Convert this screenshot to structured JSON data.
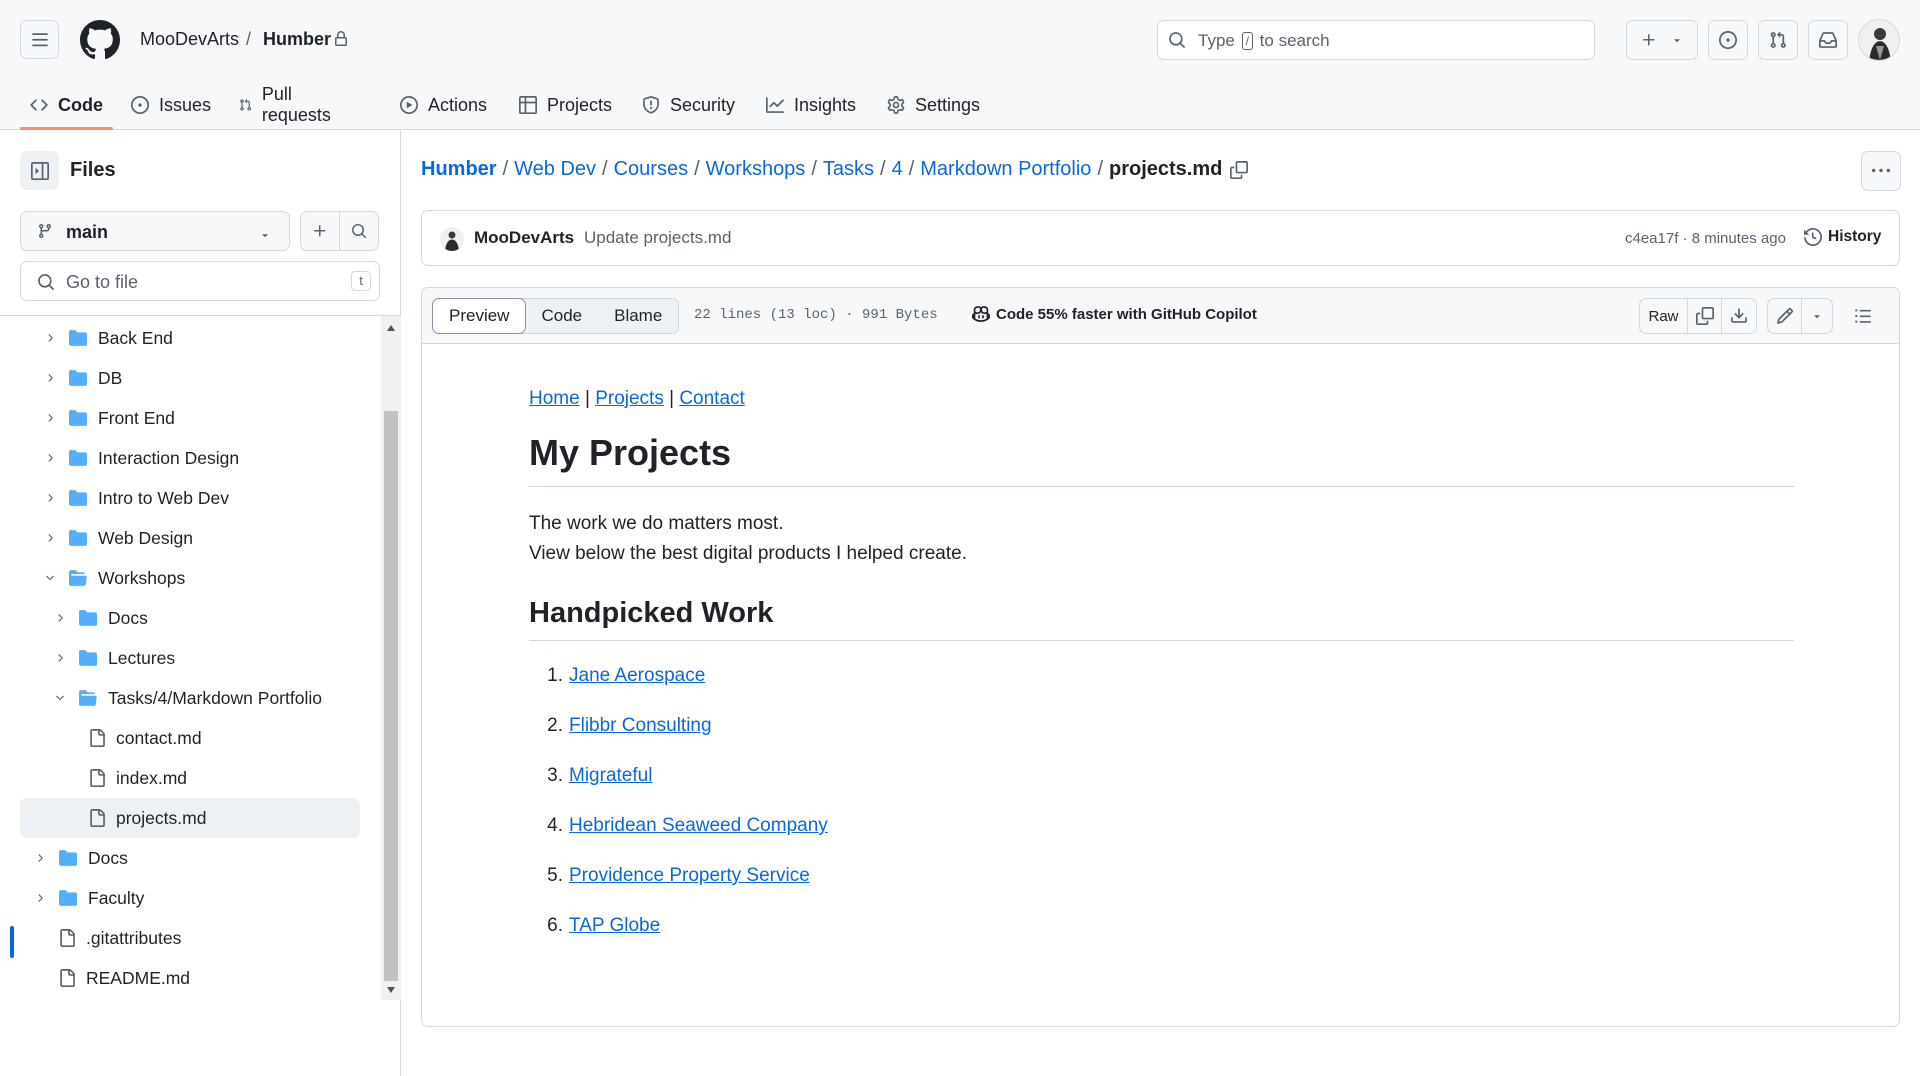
{
  "header": {
    "owner": "MooDevArts",
    "separator": "/",
    "repo": "Humber",
    "search_placeholder_pre": "Type",
    "search_key": "/",
    "search_placeholder_post": "to search"
  },
  "tabs": [
    {
      "label": "Code",
      "icon": "code-icon",
      "active": true
    },
    {
      "label": "Issues",
      "icon": "issue-opened-icon"
    },
    {
      "label": "Pull requests",
      "icon": "git-pull-request-icon"
    },
    {
      "label": "Actions",
      "icon": "play-icon"
    },
    {
      "label": "Projects",
      "icon": "table-icon"
    },
    {
      "label": "Security",
      "icon": "shield-icon"
    },
    {
      "label": "Insights",
      "icon": "graph-icon"
    },
    {
      "label": "Settings",
      "icon": "gear-icon"
    }
  ],
  "sidebar": {
    "title": "Files",
    "branch": "main",
    "goto_placeholder": "Go to file",
    "goto_key": "t",
    "tree": [
      {
        "label": "Back End",
        "type": "folder",
        "open": false
      },
      {
        "label": "DB",
        "type": "folder",
        "open": false
      },
      {
        "label": "Front End",
        "type": "folder",
        "open": false
      },
      {
        "label": "Interaction Design",
        "type": "folder",
        "open": false
      },
      {
        "label": "Intro to Web Dev",
        "type": "folder",
        "open": false
      },
      {
        "label": "Web Design",
        "type": "folder",
        "open": false
      },
      {
        "label": "Workshops",
        "type": "folder",
        "open": true
      },
      {
        "label": "Docs",
        "type": "folder",
        "open": false
      },
      {
        "label": "Lectures",
        "type": "folder",
        "open": false
      },
      {
        "label": "Tasks/4/Markdown Portfolio",
        "type": "folder",
        "open": true
      },
      {
        "label": "contact.md",
        "type": "file"
      },
      {
        "label": "index.md",
        "type": "file"
      },
      {
        "label": "projects.md",
        "type": "file",
        "selected": true
      },
      {
        "label": "Docs",
        "type": "folder",
        "open": false
      },
      {
        "label": "Faculty",
        "type": "folder",
        "open": false
      },
      {
        "label": ".gitattributes",
        "type": "file"
      },
      {
        "label": "README.md",
        "type": "file"
      }
    ]
  },
  "breadcrumb": {
    "links": [
      "Humber",
      "Web Dev",
      "Courses",
      "Workshops",
      "Tasks",
      "4",
      "Markdown Portfolio"
    ],
    "current": "projects.md"
  },
  "commit": {
    "user": "MooDevArts",
    "message": "Update projects.md",
    "meta": "c4ea17f · 8 minutes ago",
    "history_label": "History"
  },
  "file": {
    "view_tabs": [
      "Preview",
      "Code",
      "Blame"
    ],
    "active_view": "Preview",
    "info": "22 lines (13 loc) · 991 Bytes",
    "copilot": "Code 55% faster with GitHub Copilot",
    "raw_label": "Raw"
  },
  "markdown": {
    "nav_links": [
      "Home",
      "Projects",
      "Contact"
    ],
    "nav_sep": "|",
    "h1": "My Projects",
    "para_line1": "The work we do matters most.",
    "para_line2": "View below the best digital products I helped create.",
    "h2": "Handpicked Work",
    "items": [
      "Jane Aerospace",
      "Flibbr Consulting",
      "Migrateful",
      "Hebridean Seaweed Company",
      "Providence Property Service",
      "TAP Globe"
    ]
  },
  "colors": {
    "accent_link": "#0969da",
    "folder": "#54aeff",
    "tab_underline": "#fd8c73",
    "border": "#d1d9e0"
  }
}
